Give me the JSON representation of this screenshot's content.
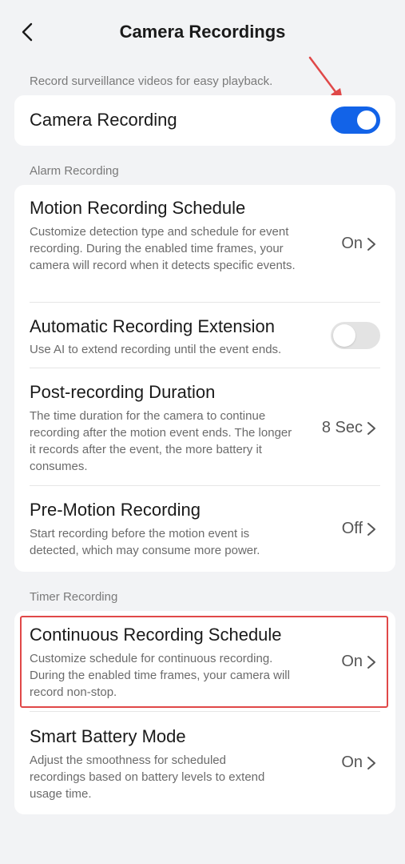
{
  "header": {
    "title": "Camera Recordings",
    "back_icon": "chevron-left-icon"
  },
  "intro": {
    "text": "Record surveillance videos for easy playback."
  },
  "camera_recording": {
    "label": "Camera Recording",
    "enabled": true
  },
  "alarm_section": {
    "label": "Alarm Recording",
    "items": [
      {
        "title": "Motion Recording Schedule",
        "desc": "Customize detection type and schedule for event recording. During the enabled time frames, your camera will record when it detects specific events.",
        "value": "On"
      },
      {
        "title": "Automatic Recording Extension",
        "desc": "Use AI to extend recording until the event ends.",
        "enabled": false
      },
      {
        "title": "Post-recording Duration",
        "desc": "The time duration for the camera to continue recording after the motion event ends. The longer it records after the event, the more battery it consumes.",
        "value": "8 Sec"
      },
      {
        "title": "Pre-Motion Recording",
        "desc": "Start recording before the motion event is detected, which may consume more power.",
        "value": "Off"
      }
    ]
  },
  "timer_section": {
    "label": "Timer Recording",
    "items": [
      {
        "title": "Continuous Recording Schedule",
        "desc": "Customize schedule for continuous recording. During the enabled time frames, your camera will record non-stop.",
        "value": "On"
      },
      {
        "title": "Smart Battery Mode",
        "desc": "Adjust the smoothness for scheduled recordings based on battery levels to extend usage time.",
        "value": "On"
      }
    ]
  },
  "colors": {
    "accent": "#1263e8",
    "highlight": "#e04848",
    "background": "#f2f3f5"
  }
}
